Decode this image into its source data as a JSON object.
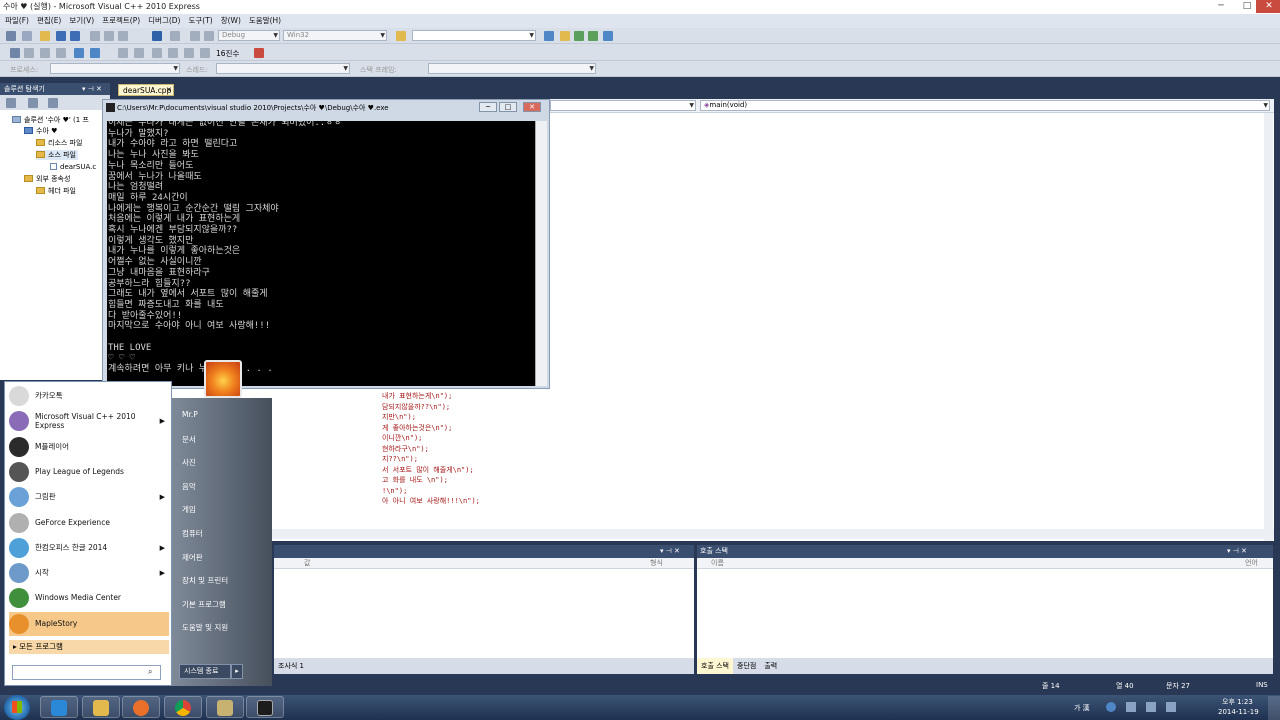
{
  "window": {
    "title": "수아 ♥ (실행) - Microsoft Visual C++ 2010 Express",
    "minimize": "─",
    "maximize": "□",
    "close": "✕"
  },
  "menu": [
    "파일(F)",
    "편집(E)",
    "보기(V)",
    "프로젝트(P)",
    "디버그(D)",
    "도구(T)",
    "창(W)",
    "도움말(H)"
  ],
  "toolbar": {
    "config": "Debug",
    "platform": "Win32",
    "hex_label": "16진수"
  },
  "debug_location": {
    "process": "프로세스:",
    "thread": "스레드:",
    "stack": "스택 프레임:"
  },
  "solution_explorer": {
    "title": "솔루션 탐색기",
    "pin": "▾ ⊣ ✕",
    "tree": [
      {
        "label": "솔루션 '수아 ♥' (1 프"
      },
      {
        "label": "수아 ♥"
      },
      {
        "label": "리소스 파일"
      },
      {
        "label": "소스 파일"
      },
      {
        "label": "dearSUA.c"
      },
      {
        "label": "외부 종속성"
      },
      {
        "label": "헤더 파일"
      }
    ]
  },
  "editor": {
    "tab": "dearSUA.cpp",
    "function_combo": "main(void)",
    "code_lines": [
      "내가 표현하는게\\n\");",
      "담되지않을까??\\n\");",
      "지만\\n\");",
      "게 좋아하는것은\\n\");",
      "이니깐\\n\");",
      "현하라구\\n\");",
      "지??\\n\");",
      "서 서포트 많이 해줄게\\n\");",
      "고 화를 내도 \\n\");",
      "!\\n\");",
      "아 아니 여보 사랑해!!!\\n\");"
    ]
  },
  "console": {
    "title": "C:\\Users\\Mr.P\\documents\\visual studio 2010\\Projects\\수아 ♥\\Debug\\수아 ♥.exe",
    "lines": [
      "이제는 누나가 내게는 없어선 안될 존재가 되버렸어..ㅎㅎ",
      "누나가 말했지?",
      "내가 수아야 라고 하면 떨린다고",
      "나는 누나 사진을 봐도",
      "누나 목소리만 들어도",
      "꿈에서 누나가 나올때도",
      "나는 엄청떨려",
      "매일 하루 24시간이",
      "나에게는 행복이고 순간순간 떨림 그자체야",
      "처음에는 이렇게 내가 표현하는게",
      "혹시 누나에겐 부담되지않을까??",
      "이렇게 생각도 했지만",
      "내가 누나를 이렇게 좋아하는것은",
      "어쩔수 없는 사실이니깐",
      "그냥 내마음을 표현하라구",
      "공부하느라 힘들지??",
      "그래도 내가 옆에서 서포트 많이 해줄게",
      "힘들면 짜증도내고 화를 내도",
      "다 받아줄수있어!!",
      "마지막으로 수아야 아니 여보 사랑해!!!",
      "",
      "THE LOVE",
      "♡ ♡ ♡",
      "계속하려면 아무 키나 누르십시오 . . ."
    ]
  },
  "panels": {
    "locals_cols": [
      "값",
      "형식"
    ],
    "callstack_title": "호출 스택",
    "callstack_cols": [
      "이름",
      "언어"
    ],
    "left_tabs": [
      "조사식 1"
    ],
    "right_tabs": [
      "호출 스택",
      "중단점",
      "출력"
    ],
    "pin": "▾ ⊣ ✕"
  },
  "status": {
    "line": "줄 14",
    "col": "열 40",
    "char": "문자 27",
    "mode": "INS"
  },
  "start_menu": {
    "programs": [
      {
        "label": "카카오톡",
        "color": "#d9d9d9",
        "arrow": ""
      },
      {
        "label": "Microsoft Visual C++ 2010 Express",
        "color": "#8a6bb8",
        "arrow": "▶"
      },
      {
        "label": "M플레이어",
        "color": "#2b2b2b",
        "arrow": ""
      },
      {
        "label": "Play League of Legends",
        "color": "#555555",
        "arrow": ""
      },
      {
        "label": "그림판",
        "color": "#6aa2d8",
        "arrow": "▶"
      },
      {
        "label": "GeForce Experience",
        "color": "#b0b0b0",
        "arrow": ""
      },
      {
        "label": "한컴오피스 한글 2014",
        "color": "#4da0d8",
        "arrow": "▶"
      },
      {
        "label": "시작",
        "color": "#6d9ac9",
        "arrow": "▶"
      },
      {
        "label": "Windows Media Center",
        "color": "#3f8f3c",
        "arrow": ""
      },
      {
        "label": "MapleStory",
        "color": "#e8902c",
        "arrow": ""
      }
    ],
    "all_programs": "모든 프로그램",
    "search_icon": "search-icon",
    "right_links": [
      "Mr.P",
      "문서",
      "사진",
      "음악",
      "게임",
      "컴퓨터",
      "제어판",
      "장치 및 프린터",
      "기본 프로그램",
      "도움말 및 지원"
    ],
    "shutdown": "시스템 종료",
    "shutdown_arrow": "▸"
  },
  "tray": {
    "time": "오후 1:23",
    "date": "2014-11-19",
    "ime": "가 漢"
  }
}
